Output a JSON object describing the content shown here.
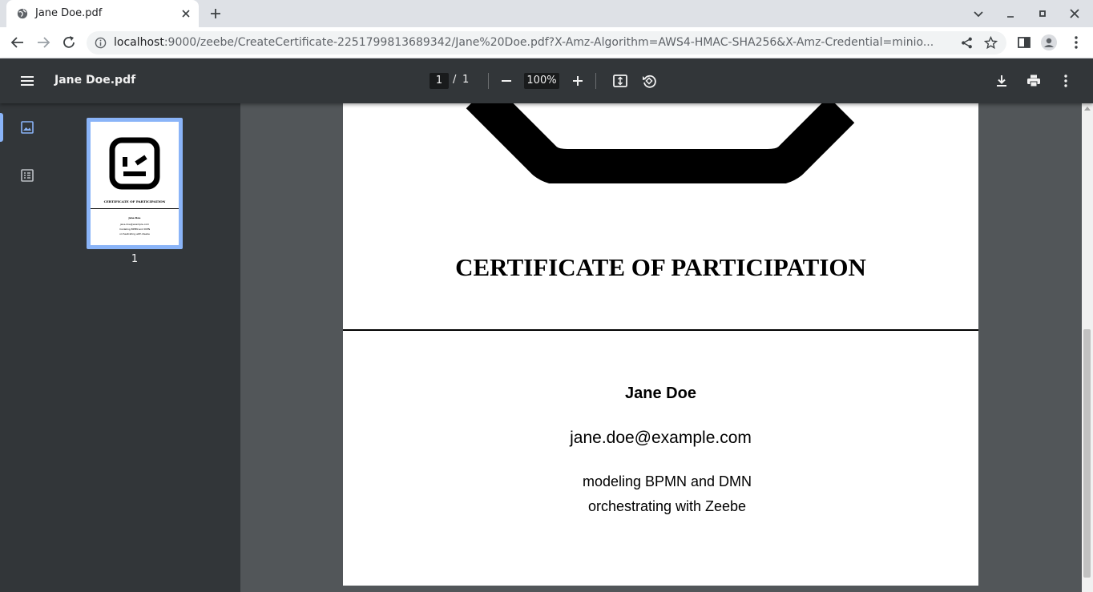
{
  "browser": {
    "tab": {
      "title": "Jane Doe.pdf",
      "favicon": "globe-icon"
    },
    "url": {
      "host": "localhost",
      "rest": ":9000/zeebe/CreateCertificate-2251799813689342/Jane%20Doe.pdf?X-Amz-Algorithm=AWS4-HMAC-SHA256&X-Amz-Credential=minio..."
    }
  },
  "viewer": {
    "title": "Jane Doe.pdf",
    "current_page": "1",
    "page_separator": "/",
    "total_pages": "1",
    "zoom": "100%",
    "thumbnail_label": "1"
  },
  "certificate": {
    "title": "CERTIFICATE OF PARTICIPATION",
    "name": "Jane Doe",
    "email": "jane.doe@example.com",
    "skills": [
      "modeling BPMN and DMN",
      "orchestrating with Zeebe"
    ]
  },
  "colors": {
    "accent": "#8ab4f8",
    "viewer_toolbar": "#323639",
    "viewer_background": "#525659"
  }
}
